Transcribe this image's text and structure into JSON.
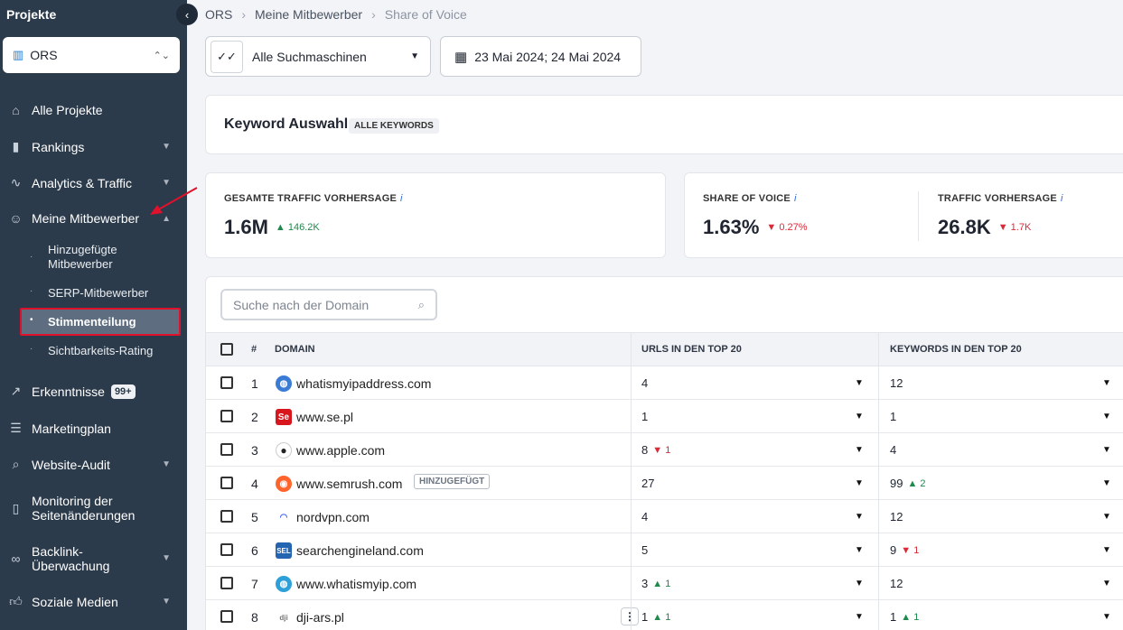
{
  "sidebar": {
    "title": "Projekte",
    "project": "ORS",
    "items": [
      {
        "label": "Alle Projekte",
        "icon": "home-icon"
      },
      {
        "label": "Rankings",
        "icon": "bar-chart-icon"
      },
      {
        "label": "Analytics & Traffic",
        "icon": "pulse-icon"
      },
      {
        "label": "Meine Mitbewerber",
        "icon": "users-icon"
      },
      {
        "label": "Erkenntnisse",
        "icon": "trend-icon",
        "badge": "99+"
      },
      {
        "label": "Marketingplan",
        "icon": "checklist-icon"
      },
      {
        "label": "Website-Audit",
        "icon": "audit-icon"
      },
      {
        "label": "Monitoring der Seitenänderungen",
        "icon": "monitor-icon"
      },
      {
        "label": "Backlink-Überwachung",
        "icon": "link-icon"
      },
      {
        "label": "Soziale Medien",
        "icon": "thumb-icon"
      }
    ],
    "sub_items": [
      {
        "label": "Hinzugefügte Mitbewerber"
      },
      {
        "label": "SERP-Mitbewerber"
      },
      {
        "label": "Stimmenteilung"
      },
      {
        "label": "Sichtbarkeits-Rating"
      }
    ]
  },
  "breadcrumb": {
    "root": "ORS",
    "middle": "Meine Mitbewerber",
    "current": "Share of Voice"
  },
  "filters": {
    "search_engine": "Alle Suchmaschinen",
    "date_range": "23 Mai 2024; 24 Mai 2024"
  },
  "keywords": {
    "title": "Keyword Auswahl",
    "badge": "ALLE KEYWORDS"
  },
  "metrics": {
    "total_traffic": {
      "label": "GESAMTE TRAFFIC VORHERSAGE",
      "value": "1.6M",
      "delta": "146.2K",
      "dir": "up"
    },
    "share_of_voice": {
      "label": "SHARE OF VOICE",
      "value": "1.63%",
      "delta": "0.27%",
      "dir": "down"
    },
    "traffic": {
      "label": "TRAFFIC VORHERSAGE",
      "value": "26.8K",
      "delta": "1.7K",
      "dir": "down"
    }
  },
  "table": {
    "search_placeholder": "Suche nach der Domain",
    "headers": {
      "num": "#",
      "domain": "DOMAIN",
      "urls": "URLS IN DEN TOP 20",
      "keywords": "KEYWORDS IN DEN TOP 20"
    },
    "rows": [
      {
        "num": "1",
        "domain": "whatismyipaddress.com",
        "fav": "globe",
        "urls": "4",
        "urls_delta": "",
        "kw": "12",
        "kw_delta": ""
      },
      {
        "num": "2",
        "domain": "www.se.pl",
        "fav": "Se",
        "urls": "1",
        "urls_delta": "",
        "kw": "1",
        "kw_delta": ""
      },
      {
        "num": "3",
        "domain": "www.apple.com",
        "fav": "apple",
        "urls": "8",
        "urls_delta": "1",
        "urls_dir": "down",
        "kw": "4",
        "kw_delta": ""
      },
      {
        "num": "4",
        "domain": "www.semrush.com",
        "fav": "semrush",
        "tag": "HINZUGEFÜGT",
        "urls": "27",
        "urls_delta": "",
        "kw": "99",
        "kw_delta": "2",
        "kw_dir": "up"
      },
      {
        "num": "5",
        "domain": "nordvpn.com",
        "fav": "nord",
        "urls": "4",
        "urls_delta": "",
        "kw": "12",
        "kw_delta": ""
      },
      {
        "num": "6",
        "domain": "searchengineland.com",
        "fav": "SEL",
        "urls": "5",
        "urls_delta": "",
        "kw": "9",
        "kw_delta": "1",
        "kw_dir": "down"
      },
      {
        "num": "7",
        "domain": "www.whatismyip.com",
        "fav": "globe2",
        "urls": "3",
        "urls_delta": "1",
        "urls_dir": "up",
        "kw": "12",
        "kw_delta": ""
      },
      {
        "num": "8",
        "domain": "dji-ars.pl",
        "fav": "dji",
        "urls": "1",
        "urls_delta": "1",
        "urls_dir": "up",
        "kw": "1",
        "kw_delta": "1",
        "kw_dir": "up"
      }
    ]
  }
}
